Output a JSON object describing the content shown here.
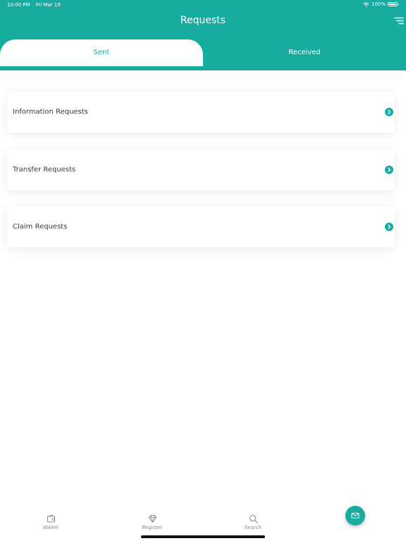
{
  "status_bar": {
    "time": "10:00 PM",
    "date": "Fri Mar 19",
    "battery": "100%"
  },
  "header": {
    "title": "Requests"
  },
  "tabs": [
    {
      "label": "Sent",
      "active": true
    },
    {
      "label": "Received",
      "active": false
    }
  ],
  "requests": [
    {
      "label": "Information Requests"
    },
    {
      "label": "Transfer Requests"
    },
    {
      "label": "Claim Requests"
    }
  ],
  "nav": {
    "wallet": "Wallet",
    "register": "Register",
    "search": "Search"
  },
  "colors": {
    "accent": "#18aca0",
    "text": "#3a3a3a",
    "muted": "#8a8a8a"
  }
}
